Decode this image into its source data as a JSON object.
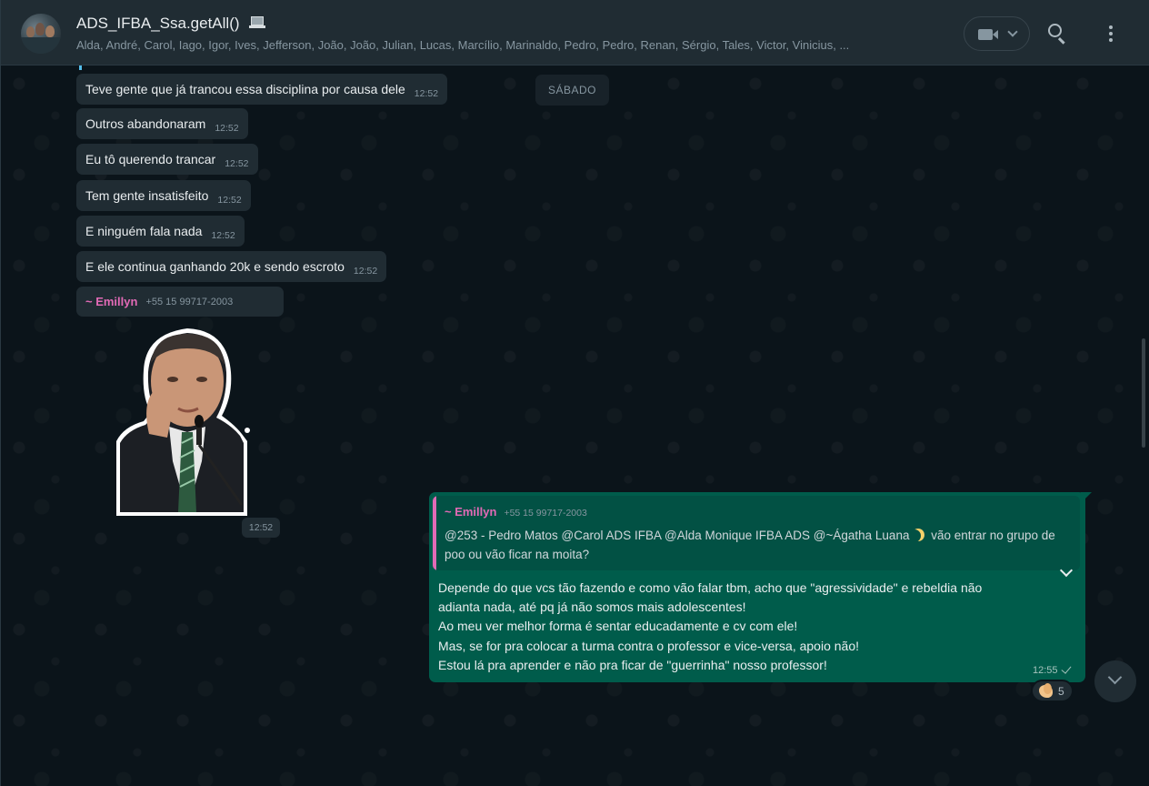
{
  "header": {
    "title": "ADS_IFBA_Ssa.getAll()",
    "title_icon": "laptop-icon",
    "members": "Alda, André, Carol, Iago, Igor, Ives, Jefferson, João, João, Julian, Lucas, Marcílio, Marinaldo, Pedro, Pedro, Renan, Sérgio, Tales, Victor, Vinicius, ...",
    "icons": [
      "video-call-icon",
      "chevron-down-icon",
      "search-icon",
      "menu-icon"
    ]
  },
  "date_chip": "SÁBADO",
  "incoming_messages": [
    {
      "text": "Teve gente que já trancou essa disciplina por causa dele",
      "time": "12:52"
    },
    {
      "text": "Outros abandonaram",
      "time": "12:52"
    },
    {
      "text": "Eu tô querendo trancar",
      "time": "12:52"
    },
    {
      "text": "Tem gente insatisfeito",
      "time": "12:52"
    },
    {
      "text": "E ninguém fala nada",
      "time": "12:52"
    },
    {
      "text": "E ele continua ganhando 20k e sendo escroto",
      "time": "12:52"
    }
  ],
  "sticker_sender": {
    "name": "~ Emillyn",
    "phone": "+55 15 99717-2003"
  },
  "sticker_time": "12:52",
  "outgoing": {
    "quote": {
      "sender": "~ Emillyn",
      "phone": "+55 15 99717-2003",
      "text_before_emoji": "@253 - Pedro Matos  @Carol ADS IFBA @Alda Monique IFBA ADS  @~Ágatha Luana",
      "emoji": "crescent-moon-icon",
      "text_after_emoji": "  vão entrar no grupo de poo ou vão ficar na moita?"
    },
    "lines": [
      "Depende do que vcs tão fazendo e como  vão falar tbm,  acho que \"agressividade\" e rebeldia não",
      "adianta nada, até pq já não somos mais adolescentes!",
      "Ao meu ver melhor forma é sentar educadamente e cv com ele!",
      "Mas, se for pra colocar a turma contra o professor e vice-versa, apoio não!",
      "Estou lá pra aprender e não pra ficar de \"guerrinha\" nosso professor!"
    ],
    "time": "12:55",
    "reaction_count": "5",
    "reaction_emoji": "clapping-hands-icon"
  },
  "colors": {
    "background": "#0b141a",
    "header": "#202c33",
    "incoming_bubble": "#202c33",
    "outgoing_bubble": "#005c4b",
    "sender_name": "#e26ab6"
  }
}
